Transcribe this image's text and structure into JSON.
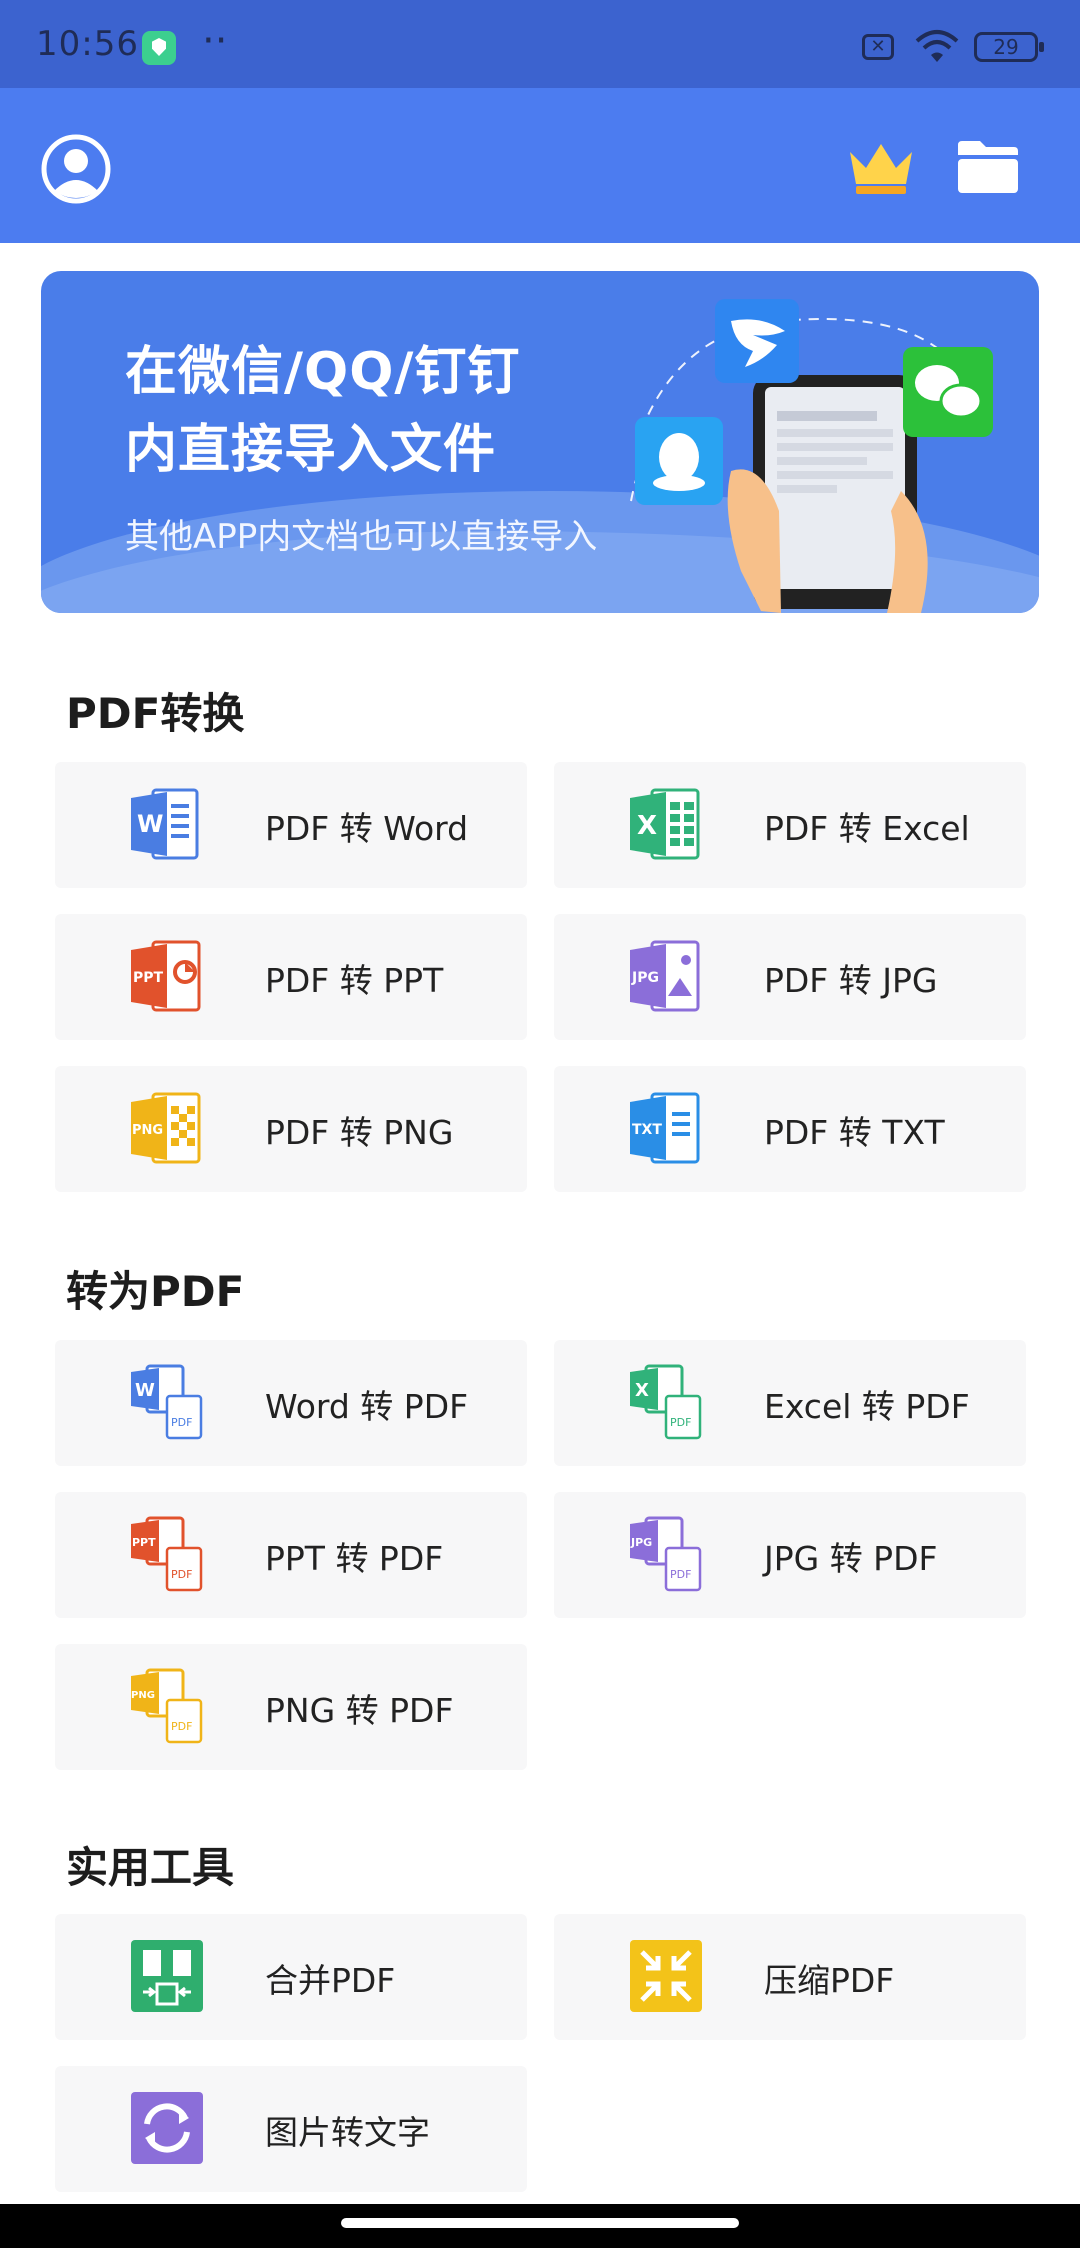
{
  "status_bar": {
    "time": "10:56",
    "dots": "··",
    "battery": "29"
  },
  "banner": {
    "line1": "在微信/QQ/钉钉",
    "line2": "内直接导入文件",
    "line3": "其他APP内文档也可以直接导入"
  },
  "sections": [
    {
      "title": "PDF转换",
      "items": [
        {
          "label": "PDF 转 Word",
          "icon": "word-icon",
          "color": "#4a7de2"
        },
        {
          "label": "PDF 转 Excel",
          "icon": "excel-icon",
          "color": "#30b27a"
        },
        {
          "label": "PDF 转 PPT",
          "icon": "ppt-icon",
          "color": "#e1522c"
        },
        {
          "label": "PDF 转 JPG",
          "icon": "jpg-icon",
          "color": "#8b6ed9"
        },
        {
          "label": "PDF 转 PNG",
          "icon": "png-icon",
          "color": "#f0b418"
        },
        {
          "label": "PDF 转 TXT",
          "icon": "txt-icon",
          "color": "#2a8ee6"
        }
      ]
    },
    {
      "title": "转为PDF",
      "items": [
        {
          "label": "Word 转 PDF",
          "icon": "word-to-pdf-icon",
          "color": "#4a7de2"
        },
        {
          "label": "Excel 转 PDF",
          "icon": "excel-to-pdf-icon",
          "color": "#30b27a"
        },
        {
          "label": "PPT 转 PDF",
          "icon": "ppt-to-pdf-icon",
          "color": "#e1522c"
        },
        {
          "label": "JPG 转 PDF",
          "icon": "jpg-to-pdf-icon",
          "color": "#8b6ed9"
        },
        {
          "label": "PNG 转 PDF",
          "icon": "png-to-pdf-icon",
          "color": "#f0b418"
        }
      ]
    },
    {
      "title": "实用工具",
      "items": [
        {
          "label": "合并PDF",
          "icon": "merge-pdf-icon",
          "color": "#2fae6e"
        },
        {
          "label": "压缩PDF",
          "icon": "compress-pdf-icon",
          "color": "#f3c319"
        },
        {
          "label": "图片转文字",
          "icon": "image-to-text-icon",
          "color": "#8b6ed9"
        }
      ]
    }
  ]
}
